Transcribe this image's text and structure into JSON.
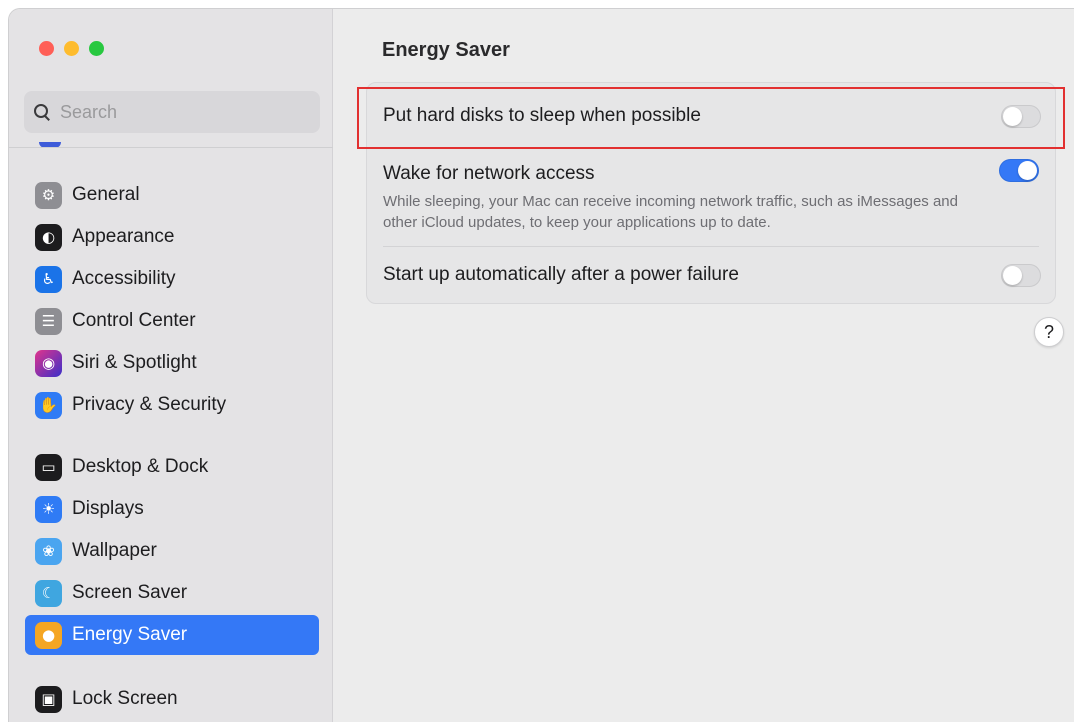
{
  "window": {
    "traffic_lights": [
      {
        "name": "close",
        "color": "#ff5f57"
      },
      {
        "name": "minimize",
        "color": "#febc2e"
      },
      {
        "name": "zoom",
        "color": "#28c840"
      }
    ]
  },
  "sidebar": {
    "search": {
      "placeholder": "Search",
      "value": ""
    },
    "groups": [
      [
        {
          "label": "General",
          "icon": "gear-icon",
          "icon_bg": "#8e8e93",
          "glyph": "⚙",
          "active": false
        },
        {
          "label": "Appearance",
          "icon": "appearance-icon",
          "icon_bg": "#1c1c1e",
          "glyph": "◐",
          "active": false
        },
        {
          "label": "Accessibility",
          "icon": "accessibility-icon",
          "icon_bg": "#1a73e8",
          "glyph": "♿",
          "active": false
        },
        {
          "label": "Control Center",
          "icon": "control-center-icon",
          "icon_bg": "#8e8e93",
          "glyph": "☰",
          "active": false
        },
        {
          "label": "Siri & Spotlight",
          "icon": "siri-icon",
          "icon_bg": "#6a3fd4",
          "glyph": "◉",
          "active": false
        },
        {
          "label": "Privacy & Security",
          "icon": "hand-icon",
          "icon_bg": "#2f7bf5",
          "glyph": "✋",
          "active": false
        }
      ],
      [
        {
          "label": "Desktop & Dock",
          "icon": "dock-icon",
          "icon_bg": "#1c1c1e",
          "glyph": "▭",
          "active": false
        },
        {
          "label": "Displays",
          "icon": "sun-icon",
          "icon_bg": "#2f7bf5",
          "glyph": "☀",
          "active": false
        },
        {
          "label": "Wallpaper",
          "icon": "flower-icon",
          "icon_bg": "#4aa5f0",
          "glyph": "❀",
          "active": false
        },
        {
          "label": "Screen Saver",
          "icon": "screen-saver-icon",
          "icon_bg": "#3fa6e0",
          "glyph": "☾",
          "active": false
        },
        {
          "label": "Energy Saver",
          "icon": "lightbulb-icon",
          "icon_bg": "#f5a623",
          "glyph": "💡",
          "active": true
        }
      ],
      [
        {
          "label": "Lock Screen",
          "icon": "lock-icon",
          "icon_bg": "#1c1c1e",
          "glyph": "🔒",
          "active": false
        }
      ]
    ]
  },
  "main": {
    "title": "Energy Saver",
    "settings": [
      {
        "label": "Put hard disks to sleep when possible",
        "description": "",
        "on": false
      },
      {
        "label": "Wake for network access",
        "description": "While sleeping, your Mac can receive incoming network traffic, such as iMessages and other iCloud updates, to keep your applications up to date.",
        "on": true
      },
      {
        "label": "Start up automatically after a power failure",
        "description": "",
        "on": false
      }
    ],
    "help_label": "?"
  },
  "colors": {
    "accent": "#3478f6",
    "highlight_box": "#e23030"
  }
}
